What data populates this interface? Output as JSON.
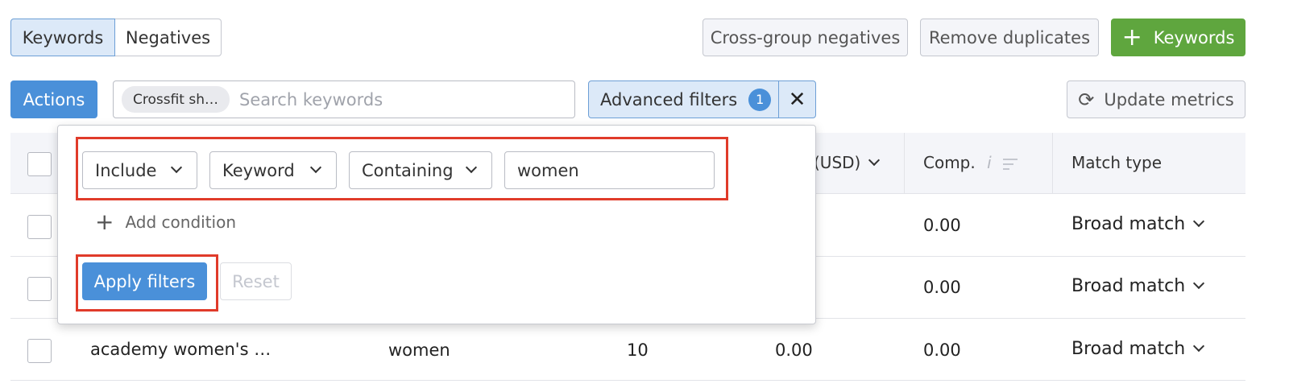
{
  "tabs": {
    "keywords": "Keywords",
    "negatives": "Negatives"
  },
  "toolbar": {
    "cross_group_negatives": "Cross-group negatives",
    "remove_duplicates": "Remove duplicates",
    "add_keywords": "Keywords",
    "add_icon": "+",
    "actions": "Actions",
    "update_metrics": "Update metrics",
    "refresh_icon": "⟳"
  },
  "search": {
    "chip": "Crossfit sh…",
    "placeholder": "Search keywords"
  },
  "advanced_filters": {
    "label": "Advanced filters",
    "count": "1",
    "close_icon": "✕"
  },
  "table": {
    "headers": {
      "cpc_partial": "(USD)",
      "comp": "Comp.",
      "info_icon": "i",
      "match_type": "Match type"
    },
    "rows": [
      {
        "keyword": "",
        "group": "",
        "volume": "",
        "cpc": "",
        "comp": "0.00",
        "match": "Broad match"
      },
      {
        "keyword": "",
        "group": "",
        "volume": "",
        "cpc": "",
        "comp": "0.00",
        "match": "Broad match"
      },
      {
        "keyword": "academy women's …",
        "group": "women",
        "volume": "10",
        "cpc": "0.00",
        "comp": "0.00",
        "match": "Broad match"
      }
    ]
  },
  "filter_popup": {
    "include": "Include",
    "field": "Keyword",
    "operator": "Containing",
    "value": "women",
    "add_condition": "Add condition",
    "plus_icon": "+",
    "apply": "Apply filters",
    "reset": "Reset"
  },
  "colors": {
    "highlight": "#e03b2a",
    "primary": "#4a90d9",
    "success": "#5fa63e"
  }
}
